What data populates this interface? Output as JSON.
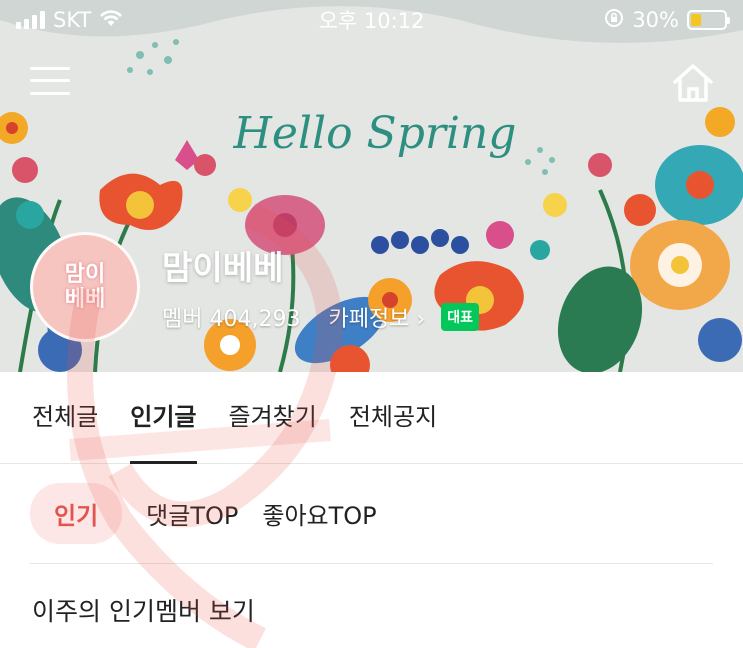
{
  "status_bar": {
    "carrier": "SKT",
    "time": "오후 10:12",
    "battery": "30%",
    "battery_level": 0.3
  },
  "banner": {
    "headline": "Hello Spring",
    "avatar_text_line1": "맘이",
    "avatar_text_line2": "베베"
  },
  "cafe": {
    "name": "맘이베베",
    "members": "멤버 404,293",
    "info_link": "카페정보 ›",
    "badge": "대표"
  },
  "tabs": [
    {
      "label": "전체글",
      "active": false
    },
    {
      "label": "인기글",
      "active": true
    },
    {
      "label": "즐겨찾기",
      "active": false
    },
    {
      "label": "전체공지",
      "active": false
    }
  ],
  "sub_tabs": [
    {
      "label": "인기",
      "active": true
    },
    {
      "label": "댓글TOP",
      "active": false
    },
    {
      "label": "좋아요TOP",
      "active": false
    }
  ],
  "weekly_link": "이주의 인기멤버 보기",
  "icons": {
    "menu": "hamburger-menu-icon",
    "home": "home-icon",
    "wifi": "wifi-icon",
    "lock": "orientation-lock-icon"
  },
  "colors": {
    "active_chip_bg": "#fde7e6",
    "active_chip_text": "#e0554f",
    "badge": "#03c75a",
    "battery": "#f7c520"
  }
}
